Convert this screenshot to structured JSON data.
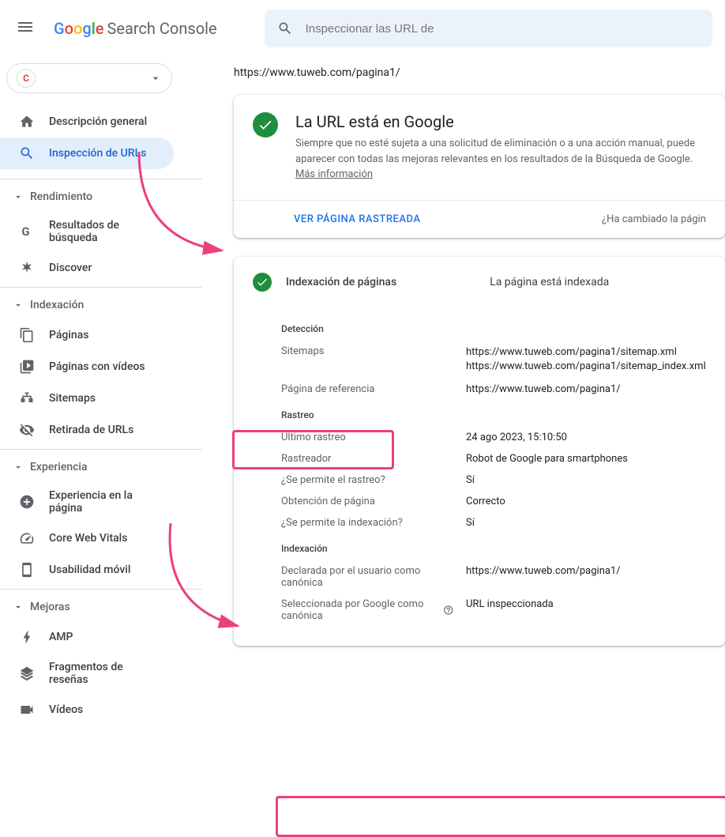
{
  "header": {
    "logo_text": "Search Console",
    "search_placeholder": "Inspeccionar las URL de"
  },
  "sidebar": {
    "items_top": [
      {
        "label": "Descripción general",
        "icon": "home"
      },
      {
        "label": "Inspección de URLs",
        "icon": "search",
        "active": true
      }
    ],
    "sections": [
      {
        "header": "Rendimiento",
        "items": [
          {
            "label": "Resultados de búsqueda",
            "icon": "g-icon"
          },
          {
            "label": "Discover",
            "icon": "asterisk"
          }
        ]
      },
      {
        "header": "Indexación",
        "items": [
          {
            "label": "Páginas",
            "icon": "pages"
          },
          {
            "label": "Páginas con vídeos",
            "icon": "video-pages"
          },
          {
            "label": "Sitemaps",
            "icon": "sitemap"
          },
          {
            "label": "Retirada de URLs",
            "icon": "eye-off"
          }
        ]
      },
      {
        "header": "Experiencia",
        "items": [
          {
            "label": "Experiencia en la página",
            "icon": "plus-circle"
          },
          {
            "label": "Core Web Vitals",
            "icon": "speed"
          },
          {
            "label": "Usabilidad móvil",
            "icon": "mobile"
          }
        ]
      },
      {
        "header": "Mejoras",
        "items": [
          {
            "label": "AMP",
            "icon": "bolt"
          },
          {
            "label": "Fragmentos de reseñas",
            "icon": "stack"
          },
          {
            "label": "Vídeos",
            "icon": "video"
          }
        ]
      }
    ]
  },
  "main": {
    "url": "https://www.tuweb.com/pagina1/",
    "status_title": "La URL está en Google",
    "status_desc": "Siempre que no esté sujeta a una solicitud de eliminación o a una acción manual, puede aparecer con todas las mejoras relevantes en los resultados de la Búsqueda de Google. ",
    "more_info": "Más información",
    "view_crawled": "VER PÁGINA RASTREADA",
    "page_changed": "¿Ha cambiado la págin",
    "indexing": {
      "title": "Indexación de páginas",
      "status": "La página está indexada",
      "sections": {
        "detection": {
          "label": "Detección",
          "sitemaps_label": "Sitemaps",
          "sitemap1": "https://www.tuweb.com/pagina1/sitemap.xml",
          "sitemap2": "https://www.tuweb.com/pagina1/sitemap_index.xml",
          "ref_label": "Página de referencia",
          "ref_value": "https://www.tuweb.com/pagina1/"
        },
        "crawl": {
          "label": "Rastreo",
          "last_crawl_label": "Último rastreo",
          "last_crawl_value": "24 ago 2023, 15:10:50",
          "crawler_label": "Rastreador",
          "crawler_value": "Robot de Google para smartphones",
          "allow_crawl_label": "¿Se permite el rastreo?",
          "allow_crawl_value": "Sí",
          "fetch_label": "Obtención de página",
          "fetch_value": "Correcto",
          "allow_index_label": "¿Se permite la indexación?",
          "allow_index_value": "Sí"
        },
        "indexation": {
          "label": "Indexación",
          "user_canon_label": "Declarada por el usuario como canónica",
          "user_canon_value": "https://www.tuweb.com/pagina1/",
          "google_canon_label": "Seleccionada por Google como canónica",
          "google_canon_value": "URL inspeccionada"
        }
      }
    }
  }
}
